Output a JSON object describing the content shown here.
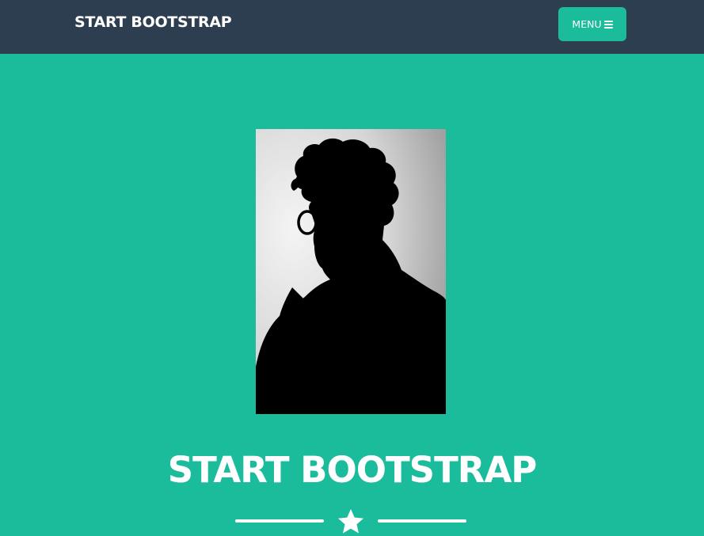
{
  "navbar": {
    "brand": "START BOOTSTRAP",
    "menu_label": "MENU",
    "menu_icon": "bars-icon",
    "background": "#2c3e50"
  },
  "masthead": {
    "avatar_icon": "person-silhouette-avatar",
    "heading": "START BOOTSTRAP",
    "divider_icon": "star-icon",
    "background": "#1abc9c"
  }
}
